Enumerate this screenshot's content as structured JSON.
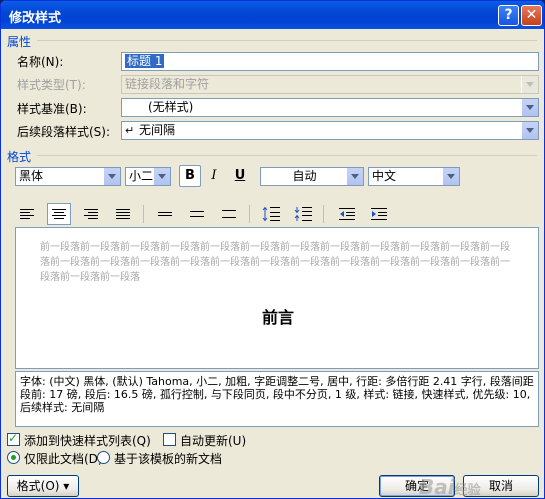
{
  "window": {
    "title": "修改样式",
    "help_label": "?",
    "close_label": "✕"
  },
  "properties": {
    "section_title": "属性",
    "name": {
      "label": "名称(N):",
      "value": "标题 1"
    },
    "style_type": {
      "label": "样式类型(T):",
      "value": "链接段落和字符"
    },
    "based_on": {
      "label": "样式基准(B):",
      "value": "(无样式)"
    },
    "next_style": {
      "label": "后续段落样式(S):",
      "value": "无间隔",
      "icon": "paragraph-return-icon"
    }
  },
  "format": {
    "section_title": "格式",
    "font": "黑体",
    "size": "小二",
    "bold_label": "B",
    "italic_label": "I",
    "underline_label": "U",
    "color": "自动",
    "script": "中文"
  },
  "preview": {
    "ghost_text": "前一段落前一段落前一段落前一段落前一段落前一段落前一段落前一段落前一段落前一段落前一段落前一段落前一段落前一段落前一段落前一段落前一段落前一段落前一段落前一段落前一段落前一段落前一段落前一段落前一段落前一段落",
    "heading_text": "前言"
  },
  "description": "字体: (中文) 黑体, (默认) Tahoma, 小二, 加粗, 字距调整二号, 居中, 行距: 多倍行距 2.41 字行, 段落间距段前: 17 磅, 段后: 16.5 磅, 孤行控制, 与下段同页, 段中不分页, 1 级, 样式: 链接, 快速样式, 优先级: 10, 后续样式: 无间隔",
  "options": {
    "add_to_quick_styles": {
      "label": "添加到快速样式列表(Q)",
      "checked": true
    },
    "auto_update": {
      "label": "自动更新(U)",
      "checked": false
    },
    "only_this_doc": {
      "label": "仅限此文档(D)",
      "checked": true
    },
    "new_docs_template": {
      "label": "基于该模板的新文档",
      "checked": false
    }
  },
  "buttons": {
    "format": "格式(O) ▾",
    "ok": "确定",
    "cancel": "取消"
  },
  "watermark": {
    "text": "Bai",
    "suffix": "经验"
  }
}
